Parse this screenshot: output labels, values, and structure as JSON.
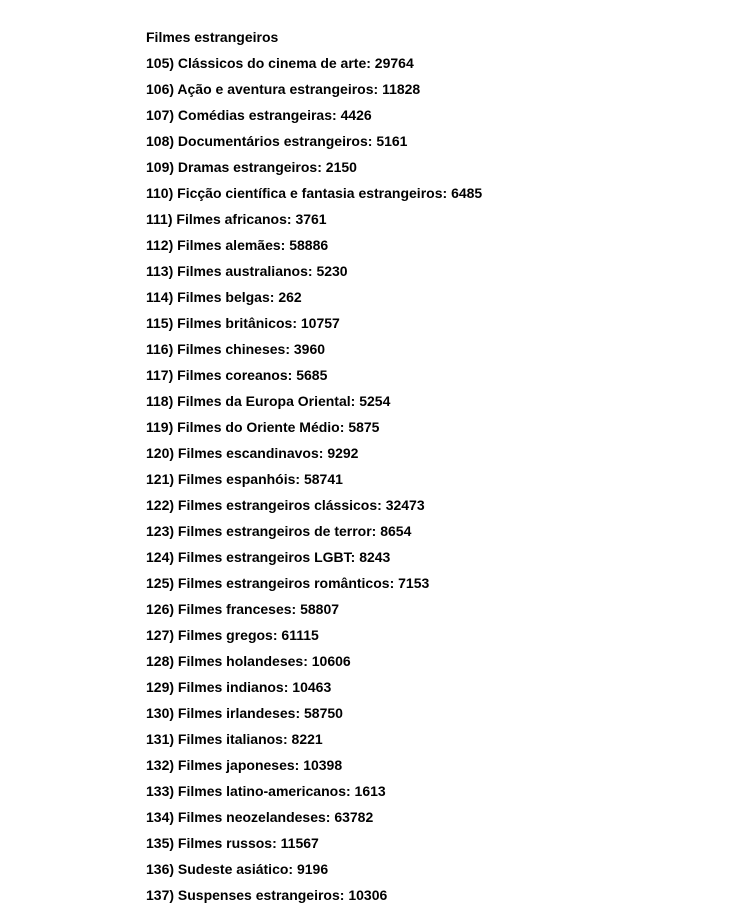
{
  "heading": "Filmes estrangeiros",
  "items": [
    {
      "num": "105",
      "label": "Clássicos do cinema de arte",
      "code": "29764"
    },
    {
      "num": "106",
      "label": "Ação e aventura estrangeiros",
      "code": "11828"
    },
    {
      "num": "107",
      "label": "Comédias estrangeiras",
      "code": "4426"
    },
    {
      "num": "108",
      "label": "Documentários estrangeiros",
      "code": "5161"
    },
    {
      "num": "109",
      "label": "Dramas estrangeiros",
      "code": "2150"
    },
    {
      "num": "110",
      "label": "Ficção científica e fantasia estrangeiros",
      "code": "6485"
    },
    {
      "num": "111",
      "label": "Filmes africanos",
      "code": "3761"
    },
    {
      "num": "112",
      "label": "Filmes alemães",
      "code": "58886"
    },
    {
      "num": "113",
      "label": "Filmes australianos",
      "code": "5230"
    },
    {
      "num": "114",
      "label": "Filmes belgas",
      "code": "262"
    },
    {
      "num": "115",
      "label": "Filmes britânicos",
      "code": "10757"
    },
    {
      "num": "116",
      "label": "Filmes chineses",
      "code": "3960"
    },
    {
      "num": "117",
      "label": "Filmes coreanos",
      "code": "5685"
    },
    {
      "num": "118",
      "label": "Filmes da Europa Oriental",
      "code": "5254"
    },
    {
      "num": "119",
      "label": "Filmes do Oriente Médio",
      "code": "5875"
    },
    {
      "num": "120",
      "label": "Filmes escandinavos",
      "code": "9292"
    },
    {
      "num": "121",
      "label": "Filmes espanhóis",
      "code": "58741"
    },
    {
      "num": "122",
      "label": "Filmes estrangeiros clássicos",
      "code": "32473"
    },
    {
      "num": "123",
      "label": "Filmes estrangeiros de terror",
      "code": "8654"
    },
    {
      "num": "124",
      "label": "Filmes estrangeiros LGBT",
      "code": "8243"
    },
    {
      "num": "125",
      "label": "Filmes estrangeiros românticos",
      "code": "7153"
    },
    {
      "num": "126",
      "label": "Filmes franceses",
      "code": "58807"
    },
    {
      "num": "127",
      "label": "Filmes gregos",
      "code": "61115"
    },
    {
      "num": "128",
      "label": "Filmes holandeses",
      "code": "10606"
    },
    {
      "num": "129",
      "label": "Filmes indianos",
      "code": "10463"
    },
    {
      "num": "130",
      "label": "Filmes irlandeses",
      "code": "58750"
    },
    {
      "num": "131",
      "label": "Filmes italianos",
      "code": "8221"
    },
    {
      "num": "132",
      "label": "Filmes japoneses",
      "code": "10398"
    },
    {
      "num": "133",
      "label": "Filmes latino-americanos",
      "code": "1613"
    },
    {
      "num": "134",
      "label": "Filmes neozelandeses",
      "code": "63782"
    },
    {
      "num": "135",
      "label": "Filmes russos",
      "code": "11567"
    },
    {
      "num": "136",
      "label": "Sudeste asiático",
      "code": "9196"
    },
    {
      "num": "137",
      "label": "Suspenses estrangeiros",
      "code": "10306"
    }
  ]
}
